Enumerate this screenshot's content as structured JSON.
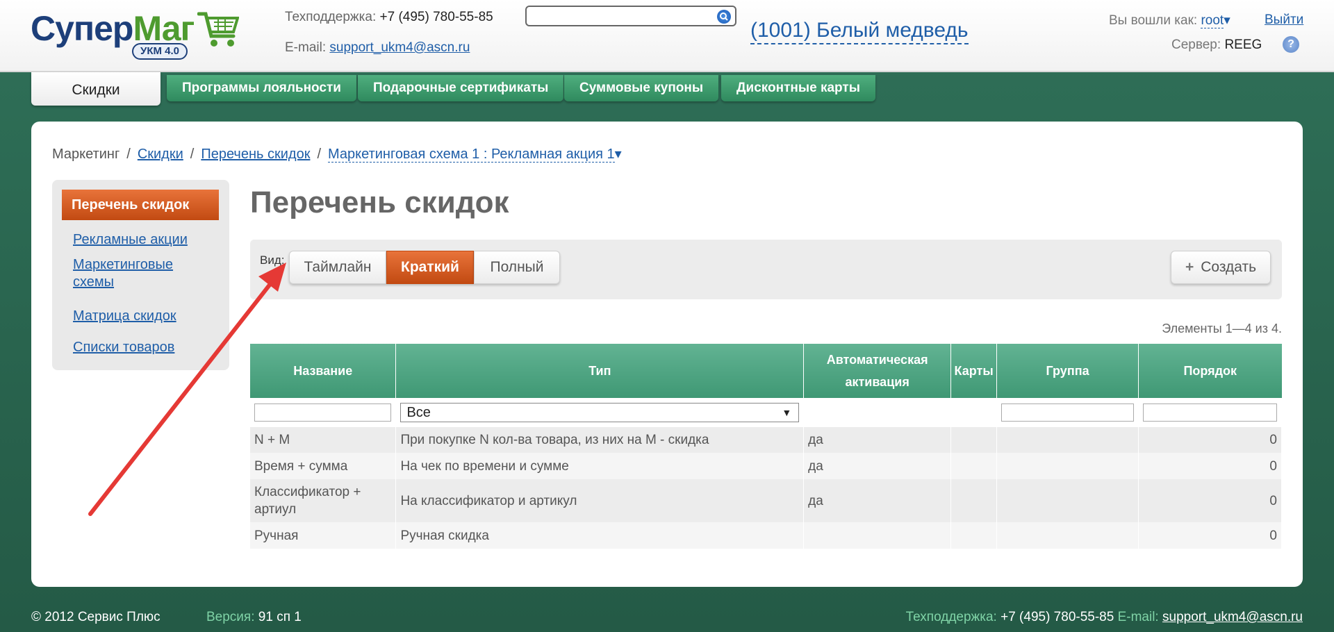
{
  "header": {
    "logo_main": "Супер",
    "logo_accent": "Маг",
    "logo_badge": "УКМ 4.0",
    "support_label": "Техподдержка:",
    "support_phone": "+7 (495) 780-55-85",
    "email_label": "E-mail:",
    "email": "support_ukm4@ascn.ru",
    "search_value": "",
    "store_name": "(1001) Белый медведь",
    "logged_as_label": "Вы вошли как:",
    "user": "root",
    "user_arrow": "▾",
    "logout": "Выйти",
    "server_label": "Сервер:",
    "server": "REEG",
    "help": "?"
  },
  "tabs": [
    {
      "label": "Скидки",
      "active": true
    },
    {
      "label": "Программы лояльности"
    },
    {
      "label": "Подарочные сертификаты"
    },
    {
      "label": "Суммовые купоны"
    },
    {
      "label": "Дисконтные карты"
    }
  ],
  "breadcrumb": {
    "root": "Маркетинг",
    "sep": "/",
    "items": [
      "Скидки",
      "Перечень скидок",
      "Маркетинговая схема 1 : Рекламная акция 1"
    ],
    "dropdown": "▾"
  },
  "sidebar": {
    "active": "Перечень скидок",
    "links": [
      "Рекламные акции",
      "Маркетинговые схемы",
      "Матрица скидок",
      "Списки товаров"
    ]
  },
  "page_title": "Перечень скидок",
  "toolbar": {
    "view_label": "Вид:",
    "views": [
      "Таймлайн",
      "Краткий",
      "Полный"
    ],
    "active_view": "Краткий",
    "create_plus": "+",
    "create_label": "Создать"
  },
  "counter": "Элементы 1—4 из 4.",
  "table": {
    "columns": [
      "Название",
      "Тип",
      "Автоматическая активация",
      "Карты",
      "Группа",
      "Порядок"
    ],
    "type_filter": "Все",
    "filter_arrow": "▼",
    "rows": [
      {
        "name": "N + M",
        "type": "При покупке N кол-ва товара, из них на М - скидка",
        "auto": "да",
        "cards": "",
        "group": "",
        "order": "0"
      },
      {
        "name": "Время + сумма",
        "type": "На чек по времени и сумме",
        "auto": "да",
        "cards": "",
        "group": "",
        "order": "0"
      },
      {
        "name": "Классификатор + артиул",
        "type": "На классификатор и артикул",
        "auto": "да",
        "cards": "",
        "group": "",
        "order": "0"
      },
      {
        "name": "Ручная",
        "type": "Ручная скидка",
        "auto": "",
        "cards": "",
        "group": "",
        "order": "0"
      }
    ]
  },
  "footer": {
    "copyright": "© 2012 Сервис Плюс",
    "version_label": "Версия:",
    "version": "91 сп 1",
    "support_label": "Техподдержка:",
    "support_phone": "+7 (495) 780-55-85",
    "email_label": "E-mail:",
    "email": "support_ukm4@ascn.ru"
  },
  "colors": {
    "background": "#2a6650",
    "accent_orange": "#d85a1f",
    "table_header": "#4fa682",
    "link": "#1f5ea8",
    "annotation_arrow": "#e53935"
  }
}
